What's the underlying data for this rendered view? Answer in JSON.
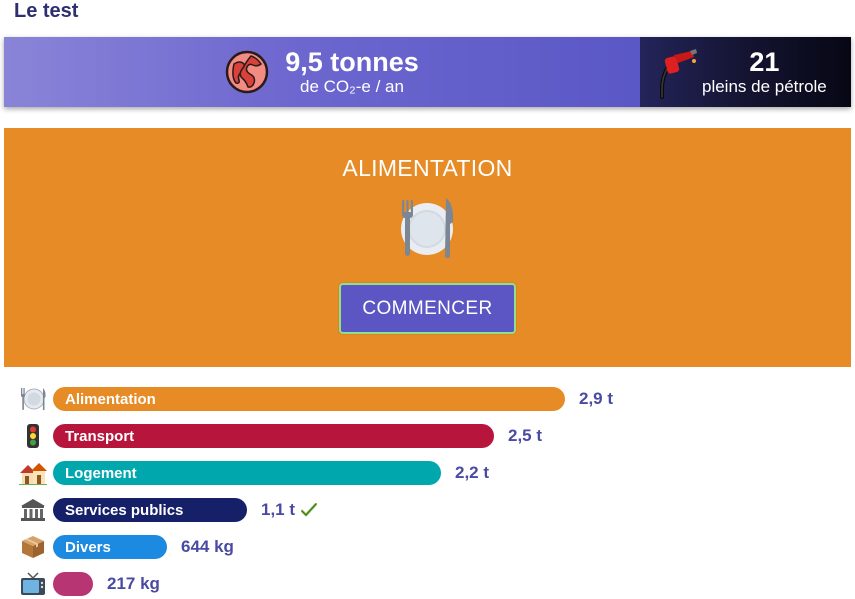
{
  "page": {
    "title": "Le test"
  },
  "summary": {
    "total_value": "9,5 tonnes",
    "total_unit": "de CO₂-e / an",
    "equivalent_value": "21",
    "equivalent_label": "pleins de pétrole",
    "globe_icon": "globe-icon",
    "pump_icon": "fuel-pump-icon"
  },
  "category_panel": {
    "title": "ALIMENTATION",
    "icon": "plate-cutlery-icon",
    "button_label": "COMMENCER",
    "background_color": "#e68b25",
    "button_color": "#5b56c3"
  },
  "categories": [
    {
      "label": "Alimentation",
      "value": "2,9 t",
      "tonnes": 2.9,
      "color": "#e68b25",
      "icon": "plate-icon",
      "checked": false
    },
    {
      "label": "Transport",
      "value": "2,5 t",
      "tonnes": 2.5,
      "color": "#b8153d",
      "icon": "traffic-light-icon",
      "checked": false
    },
    {
      "label": "Logement",
      "value": "2,2 t",
      "tonnes": 2.2,
      "color": "#00a8ad",
      "icon": "houses-icon",
      "checked": false
    },
    {
      "label": "Services publics",
      "value": "1,1 t",
      "tonnes": 1.1,
      "color": "#152068",
      "icon": "classical-building-icon",
      "checked": true
    },
    {
      "label": "Divers",
      "value": "644 kg",
      "tonnes": 0.644,
      "color": "#1c8ae0",
      "icon": "package-icon",
      "checked": false
    },
    {
      "label": "",
      "value": "217 kg",
      "tonnes": 0.217,
      "color": "#b83573",
      "icon": "television-icon",
      "checked": false
    }
  ]
}
